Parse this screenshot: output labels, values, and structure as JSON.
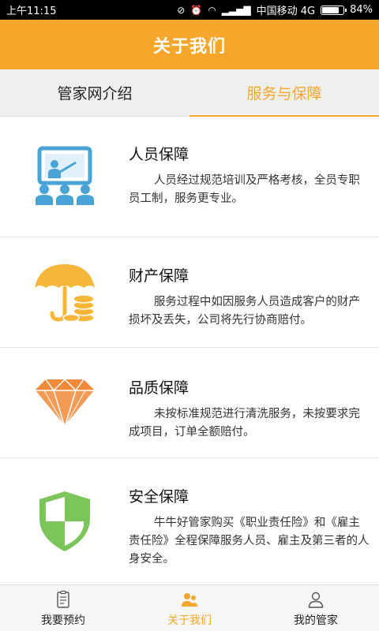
{
  "status_bar": {
    "time": "上午11:15",
    "carrier": "中国移动 4G",
    "battery": "84%",
    "battery_level": 0.84
  },
  "header": {
    "title": "关于我们"
  },
  "tabs": [
    {
      "label": "管家网介绍",
      "active": false
    },
    {
      "label": "服务与保障",
      "active": true
    }
  ],
  "items": [
    {
      "icon": "teacher-presentation-icon",
      "title": "人员保障",
      "desc": "人员经过规范培训及严格考核，全员专职员工制，服务更专业。"
    },
    {
      "icon": "umbrella-coins-icon",
      "title": "财产保障",
      "desc": "服务过程中如因服务人员造成客户的财产损坏及丢失，公司将先行协商赔付。"
    },
    {
      "icon": "diamond-icon",
      "title": "品质保障",
      "desc": "未按标准规范进行清洗服务，未按要求完成项目，订单全额赔付。"
    },
    {
      "icon": "shield-icon",
      "title": "安全保障",
      "desc": "牛牛好管家购买《职业责任险》和《雇主责任险》全程保障服务人员、雇主及第三者的人身安全。"
    }
  ],
  "bottom_nav": [
    {
      "icon": "clipboard-icon",
      "label": "我要预约",
      "active": false
    },
    {
      "icon": "people-icon",
      "label": "关于我们",
      "active": true
    },
    {
      "icon": "person-icon",
      "label": "我的管家",
      "active": false
    }
  ],
  "colors": {
    "accent": "#f5a62b",
    "shield": "#7cc55a",
    "diamond": "#f28a3c",
    "board": "#4aa3d6"
  }
}
